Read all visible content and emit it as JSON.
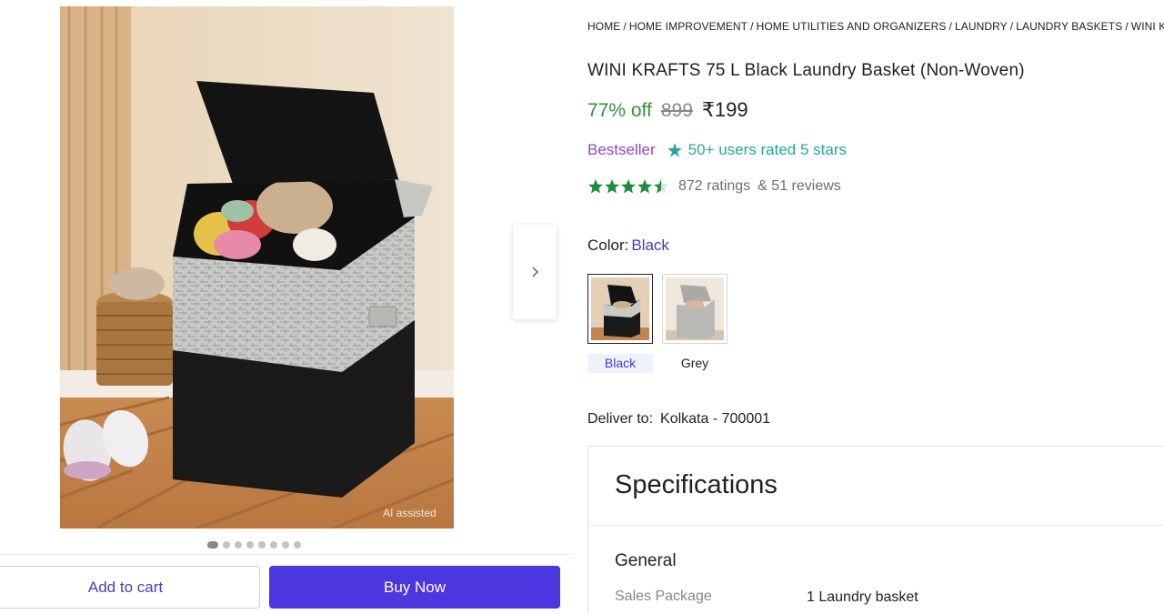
{
  "breadcrumb": [
    "HOME",
    "HOME IMPROVEMENT",
    "HOME UTILITIES AND ORGANIZERS",
    "LAUNDRY",
    "LAUNDRY BASKETS",
    "WINI KRAFTS"
  ],
  "product": {
    "title": "WINI KRAFTS 75 L Black Laundry Basket (Non-Woven)",
    "discount": "77% off",
    "mrp": "899",
    "price": "₹199",
    "bestseller": "Bestseller",
    "users_rated": "50+ users rated 5 stars",
    "rating_value": 4.5,
    "ratings_count": "872 ratings",
    "reviews_count": "& 51 reviews",
    "image_watermark": "AI assisted"
  },
  "gallery": {
    "image_count": 8,
    "active_index": 0
  },
  "color": {
    "label": "Color:",
    "selected": "Black",
    "options": [
      {
        "label": "Black"
      },
      {
        "label": "Grey"
      }
    ]
  },
  "delivery": {
    "label": "Deliver to:",
    "location": "Kolkata - 700001"
  },
  "actions": {
    "add_to_cart": "Add to cart",
    "buy_now": "Buy Now"
  },
  "specifications": {
    "title": "Specifications",
    "section": "General",
    "rows": [
      {
        "key": "Sales Package",
        "value": "1 Laundry basket"
      }
    ]
  },
  "colors": {
    "accent": "#4c36e0",
    "discount_green": "#388e3c",
    "star_green": "#1e8e3e",
    "bestseller_purple": "#8e48c7",
    "teal": "#26a69a"
  }
}
